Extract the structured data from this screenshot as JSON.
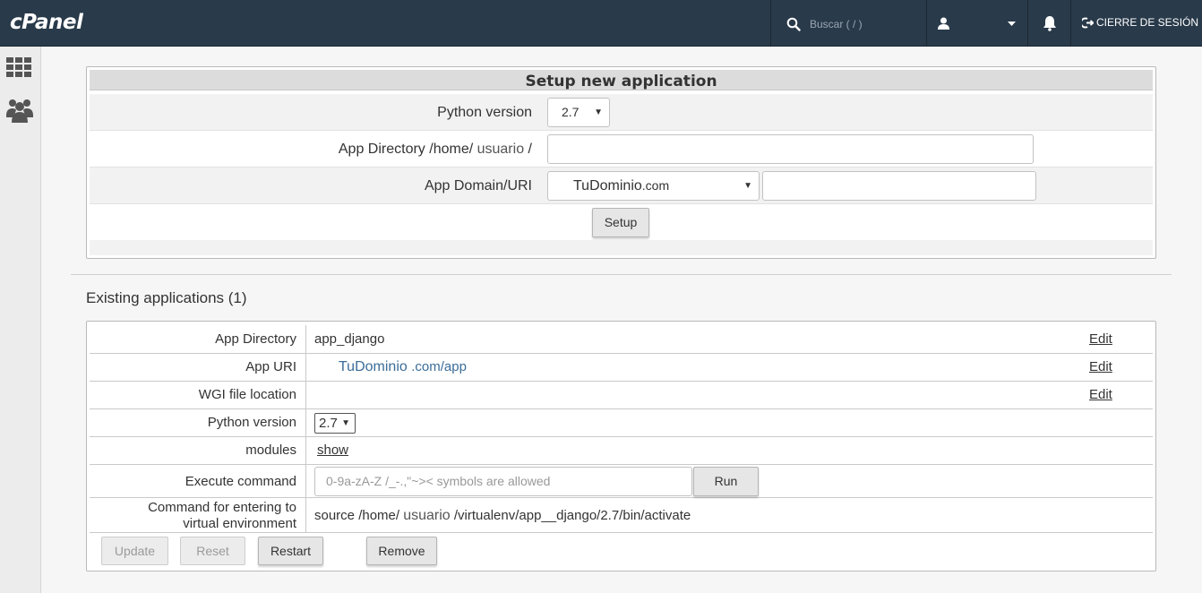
{
  "topbar": {
    "logo": "cPanel",
    "search_placeholder": "Buscar ( / )",
    "user_name": "",
    "logout_label": "CIERRE DE SESIÓN"
  },
  "sidebar": {
    "items": [
      {
        "icon": "grid-icon"
      },
      {
        "icon": "users-icon"
      }
    ]
  },
  "setup": {
    "title": "Setup new application",
    "python_label": "Python version",
    "python_value": "2.7",
    "dir_label_prefix": "App Directory /home/",
    "dir_label_user": "usuario",
    "dir_label_suffix": "/",
    "dir_value": "",
    "domain_label": "App Domain/URI",
    "domain_value_name": "TuDominio",
    "domain_value_tld": ".com",
    "uri_value": "",
    "setup_button": "Setup"
  },
  "existing": {
    "title": "Existing applications (1)",
    "rows": {
      "app_directory": {
        "label": "App Directory",
        "value": "app_django",
        "edit": "Edit"
      },
      "app_uri": {
        "label": "App URI",
        "value_name": "TuDominio",
        "value_rest": ".com/app",
        "edit": "Edit"
      },
      "wgi": {
        "label": "WGI file location",
        "value": "",
        "edit": "Edit"
      },
      "python": {
        "label": "Python version",
        "value": "2.7"
      },
      "modules": {
        "label": "modules",
        "value": "show"
      },
      "execute": {
        "label": "Execute command",
        "placeholder": "0-9a-zA-Z /_-.,\"~>< symbols are allowed",
        "run_button": "Run"
      },
      "venv": {
        "label_line1": "Command for entering to",
        "label_line2": "virtual environment",
        "value_prefix": "source /home/",
        "value_user": "usuario",
        "value_suffix": "/virtualenv/app__django/2.7/bin/activate"
      }
    },
    "buttons": {
      "update": "Update",
      "reset": "Reset",
      "restart": "Restart",
      "remove": "Remove"
    }
  },
  "colors": {
    "topbar": "#293a4a",
    "link": "#3b6d99"
  }
}
